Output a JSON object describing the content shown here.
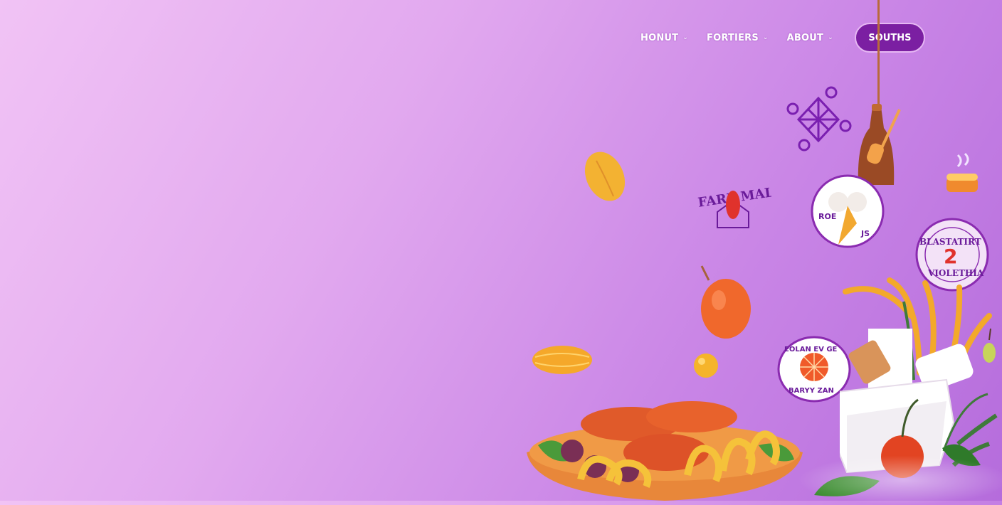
{
  "nav": {
    "items": [
      {
        "label": "HONUT"
      },
      {
        "label": "FORTIERS"
      },
      {
        "label": "ABOUT"
      }
    ],
    "cta_label": "SOUTHS"
  },
  "badges": {
    "badge_1": {
      "lettering": "FARE MAL"
    },
    "badge_2": {
      "lettering": "ROE JS"
    },
    "badge_3": {
      "lettering": "BLASTATIRT VIOLETHIA"
    },
    "badge_4": {
      "lettering": "EOLAN EV GE BARYY ZAN"
    }
  },
  "colors": {
    "accent": "#7b1fa2",
    "background": "#d99bee",
    "nav_text": "#ffffff"
  },
  "icons": [
    "chevron-down-icon",
    "spatula-icon",
    "ornament-icon",
    "cake-icon"
  ]
}
